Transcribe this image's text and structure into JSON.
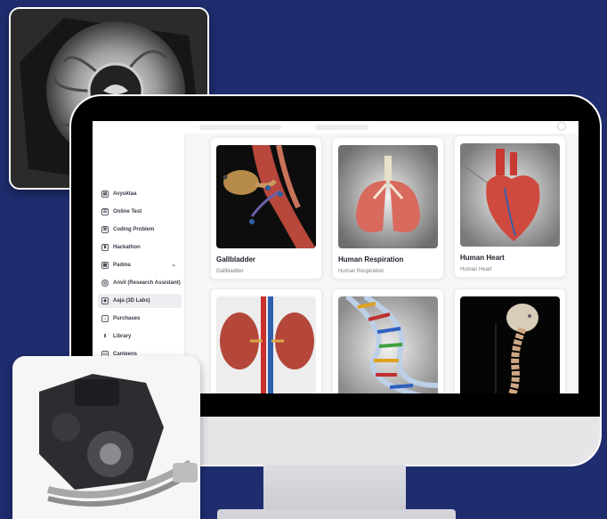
{
  "sidebar": {
    "items": [
      {
        "label": "Avyuktaa",
        "icon": "document-icon"
      },
      {
        "label": "Online Test",
        "icon": "test-icon"
      },
      {
        "label": "Coding Problem",
        "icon": "code-icon"
      },
      {
        "label": "Hackathon",
        "icon": "trophy-icon"
      },
      {
        "label": "Padma",
        "icon": "grid-icon"
      },
      {
        "label": "Anvil (Research Assistant)",
        "icon": "research-icon"
      },
      {
        "label": "Aaja (3D Labs)",
        "icon": "cube-icon"
      },
      {
        "label": "Purchases",
        "icon": "bag-icon"
      },
      {
        "label": "Library",
        "icon": "library-icon"
      },
      {
        "label": "Canteens",
        "icon": "canteen-icon"
      }
    ]
  },
  "cards": [
    {
      "title": "Gallbladder",
      "subtitle": "Gallbladder"
    },
    {
      "title": "Human Respiration",
      "subtitle": "Human Respiration"
    },
    {
      "title": "Human Heart",
      "subtitle": "Human Heart"
    },
    {
      "title": "",
      "subtitle": ""
    },
    {
      "title": "",
      "subtitle": ""
    },
    {
      "title": "",
      "subtitle": ""
    }
  ],
  "colors": {
    "background": "#1f2c6e",
    "monitor": "#e6e6e9",
    "screen": "#f7f7f9"
  }
}
